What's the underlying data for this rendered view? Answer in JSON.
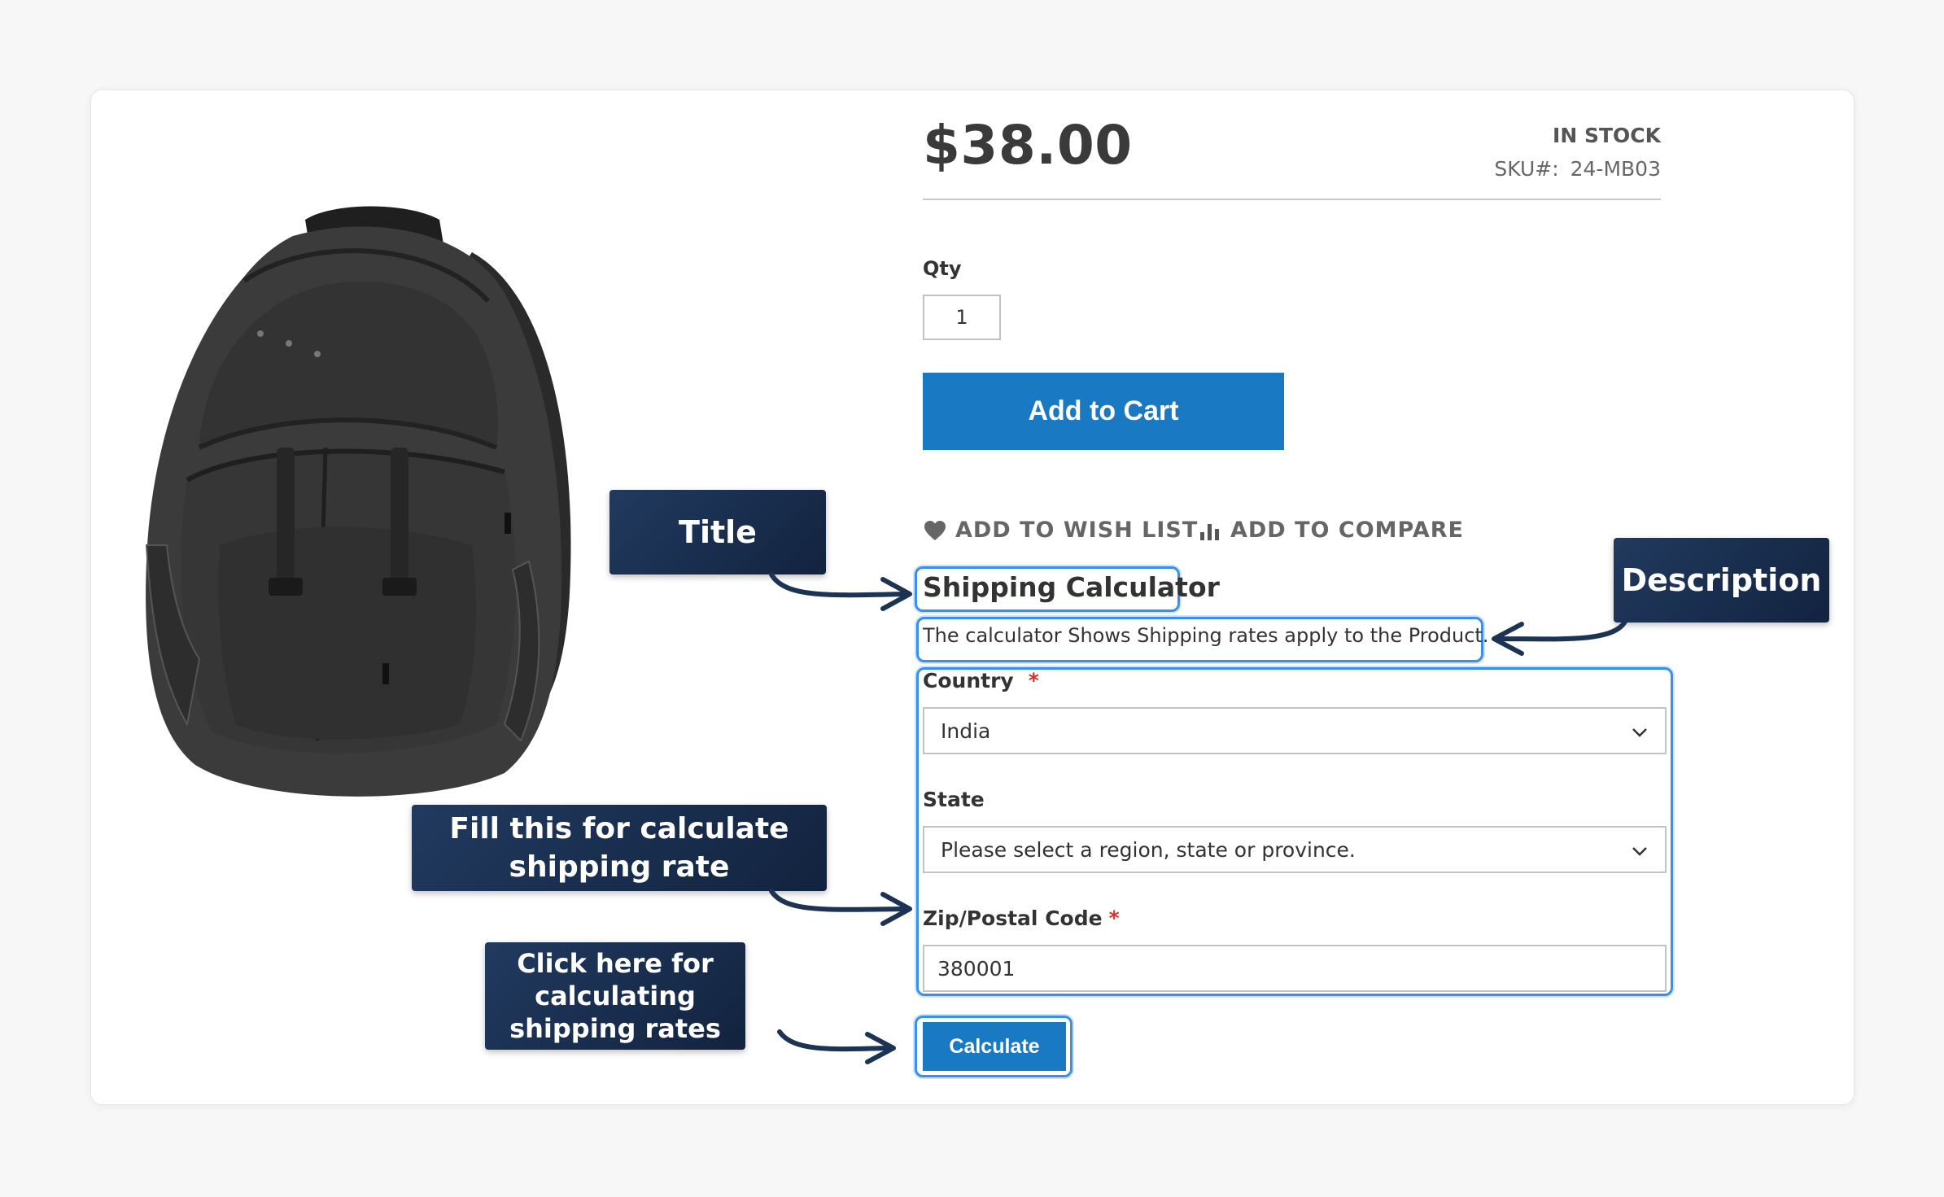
{
  "product": {
    "price": "$38.00",
    "stock": "IN STOCK",
    "sku_label": "SKU#:",
    "sku_value": "24-MB03",
    "qty_label": "Qty",
    "qty_value": "1",
    "add_to_cart": "Add to Cart",
    "wish_list": "ADD TO WISH LIST",
    "compare": "ADD TO COMPARE"
  },
  "calculator": {
    "title": "Shipping Calculator",
    "description": "The calculator Shows Shipping rates apply to the Product.",
    "country_label": "Country",
    "country_value": "India",
    "state_label": "State",
    "state_value": "Please select a region, state or province.",
    "zip_label": "Zip/Postal Code",
    "zip_value": "380001",
    "required_mark": "*",
    "calculate_button": "Calculate"
  },
  "callouts": {
    "title": "Title",
    "description": "Description",
    "fill_line1": "Fill this for calculate",
    "fill_line2": "shipping rate",
    "click_line1": "Click here for",
    "click_line2": "calculating",
    "click_line3": "shipping rates"
  },
  "colors": {
    "accent": "#1979c3",
    "highlight": "#3a8fe8",
    "callout": "#1a2f52",
    "required": "#e02b27"
  },
  "icons": [
    "backpack-image",
    "heart-icon",
    "bar-chart-icon",
    "chevron-down-icon",
    "curved-arrow-icon"
  ]
}
